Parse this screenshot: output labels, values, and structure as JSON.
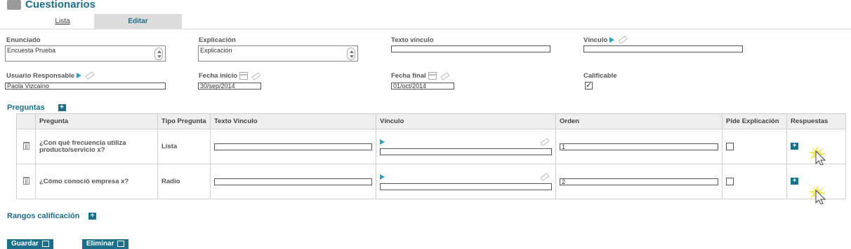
{
  "header": {
    "title": "Cuestionarios"
  },
  "tabs": [
    {
      "label": "Lista"
    },
    {
      "label": "Editar"
    }
  ],
  "form": {
    "enunciado": {
      "label": "Enunciado",
      "value": "Encuesta Prueba"
    },
    "explicacion": {
      "label": "Explicación",
      "value": "Explicación"
    },
    "texto_vinculo": {
      "label": "Texto vínculo",
      "value": ""
    },
    "vinculo": {
      "label": "Vínculo",
      "value": ""
    },
    "usuario": {
      "label": "Usuario Responsable",
      "value": "Paola Vizcaíno"
    },
    "fecha_inicio": {
      "label": "Fecha inicio",
      "value": "30/sep/2014"
    },
    "fecha_final": {
      "label": "Fecha final",
      "value": "01/oct/2014"
    },
    "calificable": {
      "label": "Calificable",
      "checked": true
    }
  },
  "preguntas": {
    "title": "Preguntas",
    "columns": [
      "Pregunta",
      "Tipo Pregunta",
      "Texto Vínculo",
      "Vínculo",
      "Orden",
      "Pide Explicación",
      "Respuestas"
    ],
    "rows": [
      {
        "pregunta": "¿Con qué frecuencia utiliza producto/servicio x?",
        "tipo": "Lista",
        "texto_vinculo": "",
        "vinculo": "",
        "orden": "1",
        "pide_explicacion": false
      },
      {
        "pregunta": "¿Cómo conoció empresa x?",
        "tipo": "Radio",
        "texto_vinculo": "",
        "vinculo": "",
        "orden": "2",
        "pide_explicacion": false
      }
    ]
  },
  "rangos": {
    "title": "Rangos calificación"
  },
  "buttons": {
    "guardar": "Guardar",
    "eliminar": "Eliminar"
  },
  "colors": {
    "accent": "#1b6f8a",
    "play": "#2aa0c8"
  }
}
